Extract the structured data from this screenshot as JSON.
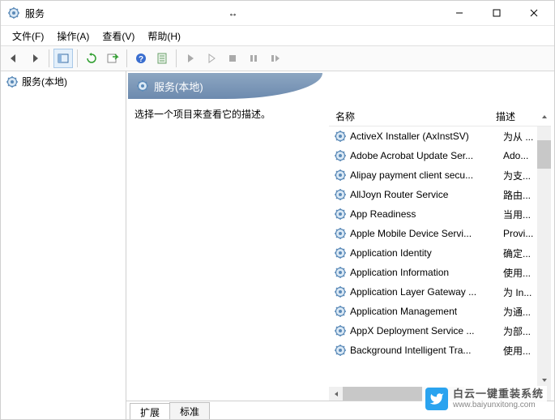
{
  "window": {
    "title": "服务",
    "menu": {
      "file": "文件(F)",
      "action": "操作(A)",
      "view": "查看(V)",
      "help": "帮助(H)"
    }
  },
  "tree": {
    "root": "服务(本地)"
  },
  "detail": {
    "header": "服务(本地)",
    "prompt": "选择一个项目来查看它的描述。"
  },
  "columns": {
    "name": "名称",
    "desc": "描述"
  },
  "services": [
    {
      "name": "ActiveX Installer (AxInstSV)",
      "desc": "为从 ..."
    },
    {
      "name": "Adobe Acrobat Update Ser...",
      "desc": "Ado..."
    },
    {
      "name": "Alipay payment client secu...",
      "desc": "为支..."
    },
    {
      "name": "AllJoyn Router Service",
      "desc": "路由..."
    },
    {
      "name": "App Readiness",
      "desc": "当用..."
    },
    {
      "name": "Apple Mobile Device Servi...",
      "desc": "Provi..."
    },
    {
      "name": "Application Identity",
      "desc": "确定..."
    },
    {
      "name": "Application Information",
      "desc": "使用..."
    },
    {
      "name": "Application Layer Gateway ...",
      "desc": "为 In..."
    },
    {
      "name": "Application Management",
      "desc": "为通..."
    },
    {
      "name": "AppX Deployment Service ...",
      "desc": "为部..."
    },
    {
      "name": "Background Intelligent Tra...",
      "desc": "使用..."
    }
  ],
  "tabs": {
    "extended": "扩展",
    "standard": "标准"
  },
  "watermark": {
    "main": "白云一键重装系统",
    "url": "www.baiyunxitong.com"
  }
}
